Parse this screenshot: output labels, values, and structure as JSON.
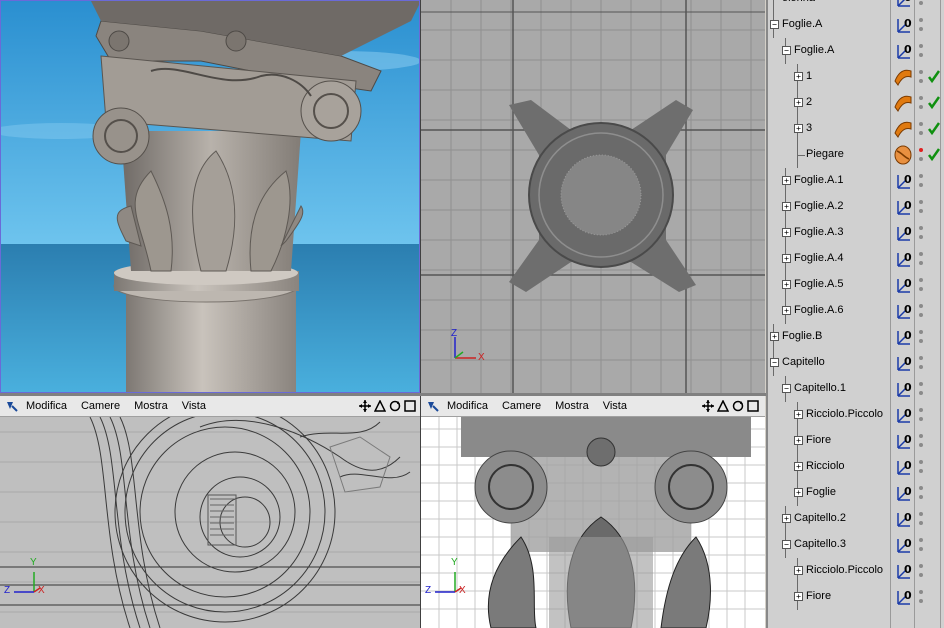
{
  "viewports": {
    "bottom_left": {
      "menus": [
        "Modifica",
        "Camere",
        "Mostra",
        "Vista"
      ]
    },
    "bottom_right": {
      "menus": [
        "Modifica",
        "Camere",
        "Mostra",
        "Vista"
      ]
    }
  },
  "axes": {
    "z": "Z",
    "y": "Y",
    "x": "X"
  },
  "object_manager": {
    "rows": [
      {
        "label": "olonna",
        "depth": 0,
        "expander": "none"
      },
      {
        "label": "Foglie.A",
        "depth": 0,
        "expander": "minus"
      },
      {
        "label": "Foglie.A",
        "depth": 1,
        "expander": "minus"
      },
      {
        "label": "1",
        "depth": 2,
        "expander": "plus",
        "icon": "bend-object-icon",
        "check": true
      },
      {
        "label": "2",
        "depth": 2,
        "expander": "plus",
        "icon": "bend-object-icon",
        "check": true
      },
      {
        "label": "3",
        "depth": 2,
        "expander": "plus",
        "icon": "bend-object-icon",
        "check": true
      },
      {
        "label": "Piegare",
        "depth": 2,
        "expander": "none",
        "icon": "bend-deformer-icon",
        "check": true,
        "red_dot": true
      },
      {
        "label": "Foglie.A.1",
        "depth": 1,
        "expander": "plus"
      },
      {
        "label": "Foglie.A.2",
        "depth": 1,
        "expander": "plus"
      },
      {
        "label": "Foglie.A.3",
        "depth": 1,
        "expander": "plus"
      },
      {
        "label": "Foglie.A.4",
        "depth": 1,
        "expander": "plus"
      },
      {
        "label": "Foglie.A.5",
        "depth": 1,
        "expander": "plus"
      },
      {
        "label": "Foglie.A.6",
        "depth": 1,
        "expander": "plus"
      },
      {
        "label": "Foglie.B",
        "depth": 0,
        "expander": "plus"
      },
      {
        "label": "Capitello",
        "depth": 0,
        "expander": "minus"
      },
      {
        "label": "Capitello.1",
        "depth": 1,
        "expander": "minus"
      },
      {
        "label": "Ricciolo.Piccolo",
        "depth": 2,
        "expander": "plus"
      },
      {
        "label": "Fiore",
        "depth": 2,
        "expander": "plus"
      },
      {
        "label": "Ricciolo",
        "depth": 2,
        "expander": "plus"
      },
      {
        "label": "Foglie",
        "depth": 2,
        "expander": "plus"
      },
      {
        "label": "Capitello.2",
        "depth": 1,
        "expander": "plus"
      },
      {
        "label": "Capitello.3",
        "depth": 1,
        "expander": "minus"
      },
      {
        "label": "Ricciolo.Piccolo",
        "depth": 2,
        "expander": "plus"
      },
      {
        "label": "Fiore",
        "depth": 2,
        "expander": "plus"
      }
    ]
  },
  "colors": {
    "sky": "#3aa3d8",
    "sea": "#2f86b5",
    "stone": "#9a948e",
    "check": "#109010",
    "bend_icon": "#e07a10"
  }
}
